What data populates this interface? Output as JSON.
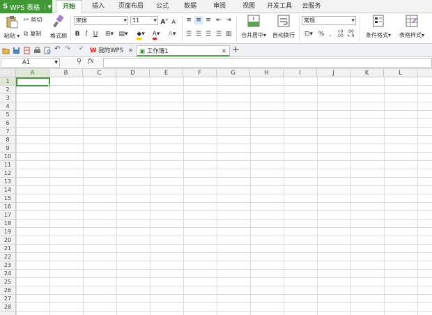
{
  "app": {
    "title": "WPS 表格"
  },
  "ribbon_tabs": [
    "开始",
    "插入",
    "页面布局",
    "公式",
    "数据",
    "审阅",
    "视图",
    "开发工具",
    "云服务"
  ],
  "active_tab": "开始",
  "clipboard": {
    "paste": "粘贴",
    "cut": "剪切",
    "copy": "复制",
    "format_painter": "格式刷"
  },
  "font": {
    "name": "宋体",
    "size": "11"
  },
  "alignment": {
    "merge_center": "合并居中",
    "wrap_text": "自动换行"
  },
  "number": {
    "format": "常规",
    "percent": "%"
  },
  "styles": {
    "conditional_format": "条件格式",
    "table_style": "表格样式"
  },
  "doc_tabs": [
    {
      "label": "我的WPS"
    },
    {
      "label": "工作簿1"
    }
  ],
  "formula_bar": {
    "name_box": "A1",
    "fx": "fx",
    "value": ""
  },
  "columns": [
    "A",
    "B",
    "C",
    "D",
    "E",
    "F",
    "G",
    "H",
    "I",
    "J",
    "K",
    "L"
  ],
  "rows": [
    "1",
    "2",
    "3",
    "4",
    "5",
    "6",
    "7",
    "8",
    "9",
    "10",
    "11",
    "12",
    "13",
    "14",
    "15",
    "16",
    "17",
    "18",
    "19",
    "20",
    "21",
    "22",
    "23",
    "24",
    "25",
    "26",
    "27",
    "28"
  ],
  "selected_cell": "A1",
  "colors": {
    "accent": "#3f9a35",
    "selection": "#3f9a35"
  }
}
